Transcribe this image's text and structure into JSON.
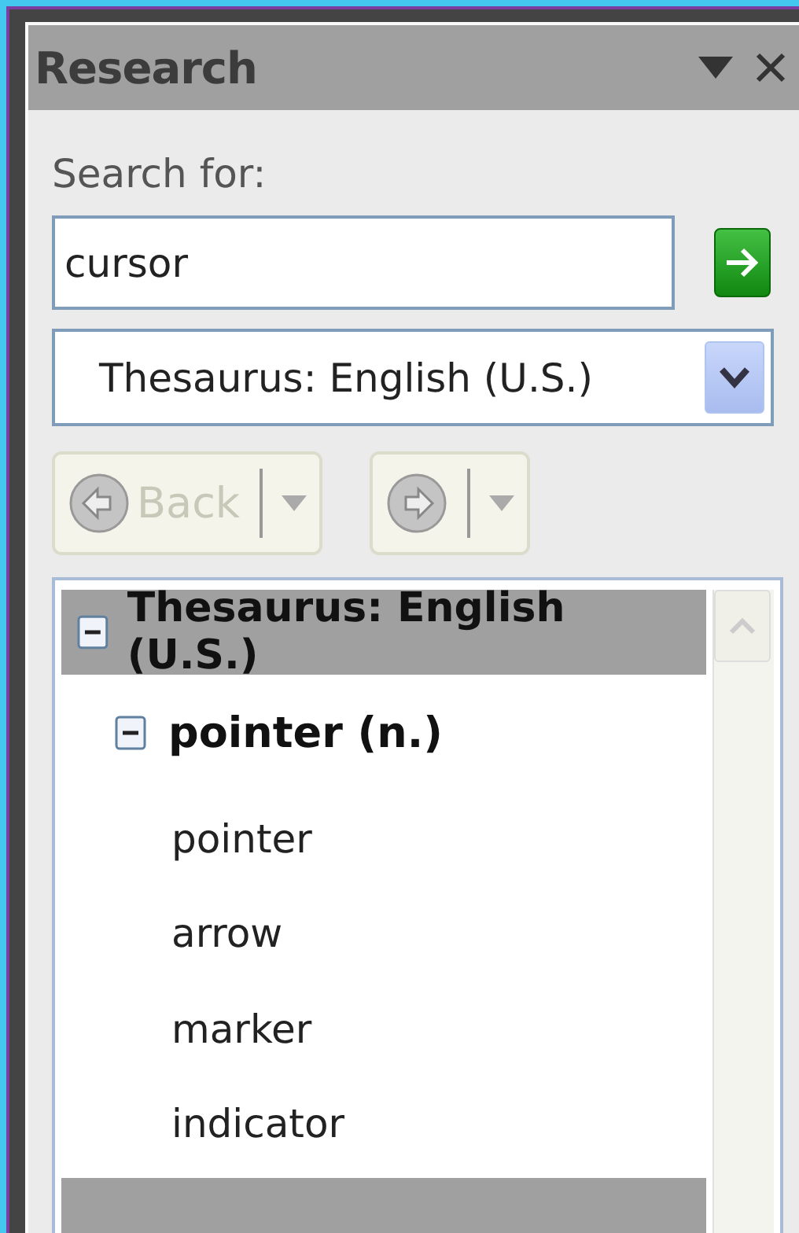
{
  "panel": {
    "title": "Research"
  },
  "search": {
    "label": "Search for:",
    "value": "cursor"
  },
  "source": {
    "value": "Thesaurus: English (U.S.)"
  },
  "nav": [
    {
      "kind": "back",
      "label": "Back",
      "disabled": true
    },
    {
      "kind": "forward",
      "disabled": true
    }
  ],
  "results": [
    {
      "label": "Thesaurus: English (U.S.)",
      "expanded": true,
      "children": [
        {
          "label": "pointer (n.)",
          "expanded": true,
          "children": [
            {
              "label": "pointer"
            },
            {
              "label": "arrow"
            },
            {
              "label": "marker"
            },
            {
              "label": "indicator"
            }
          ]
        }
      ]
    }
  ]
}
